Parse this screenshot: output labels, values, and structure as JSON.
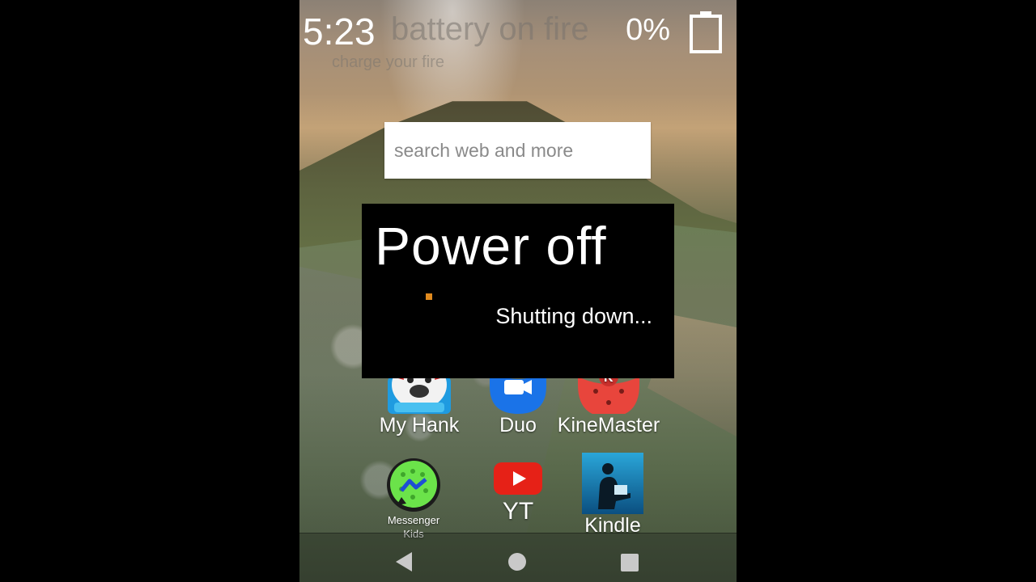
{
  "status_bar": {
    "time": "5:23",
    "battery_percent": "0%",
    "battery_level": 0
  },
  "wallpaper_text": {
    "title": "battery on fire",
    "subtitle": "charge your fire"
  },
  "search": {
    "placeholder": "search web and more",
    "value": ""
  },
  "dialog": {
    "title": "Power off",
    "message": "Shutting down...",
    "spinner_color": "#e08a1e"
  },
  "apps": [
    {
      "label": "My Hank",
      "icon": "my-hank-icon"
    },
    {
      "label": "Duo",
      "icon": "duo-icon"
    },
    {
      "label": "KineMaster",
      "icon": "kinemaster-icon"
    },
    {
      "label": "Messenger Kids",
      "icon": "messenger-kids-icon"
    },
    {
      "label": "YT",
      "icon": "youtube-icon"
    },
    {
      "label": "Kindle",
      "icon": "kindle-icon"
    }
  ],
  "nav_bar": {
    "buttons": [
      "back",
      "home",
      "recents"
    ],
    "button_color": "#c9c9c9"
  }
}
